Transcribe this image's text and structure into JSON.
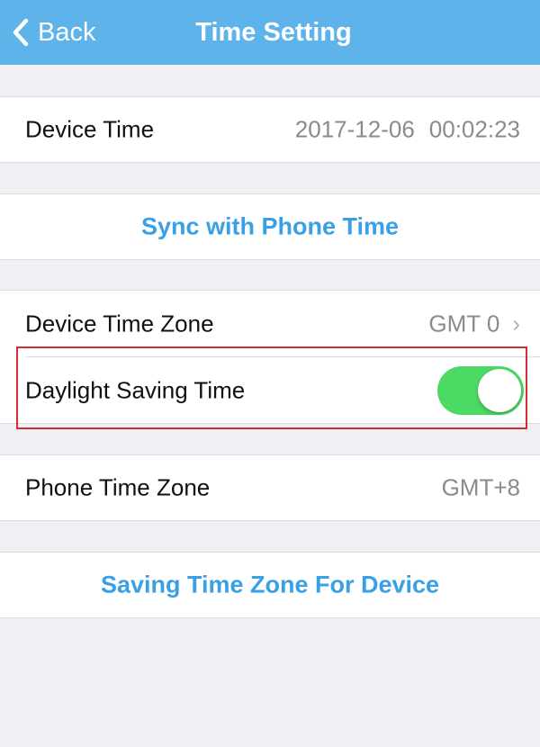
{
  "navbar": {
    "back_label": "Back",
    "title": "Time Setting"
  },
  "device_time": {
    "label": "Device Time",
    "date": "2017-12-06",
    "time": "00:02:23"
  },
  "sync_button": "Sync with Phone Time",
  "device_time_zone": {
    "label": "Device Time Zone",
    "value": "GMT 0",
    "chevron": "›"
  },
  "daylight_saving": {
    "label": "Daylight Saving Time",
    "enabled": true
  },
  "phone_time_zone": {
    "label": "Phone Time Zone",
    "value": "GMT+8"
  },
  "save_button": "Saving Time Zone For Device",
  "colors": {
    "navbar": "#5db3ea",
    "action_text": "#3aa0e6",
    "toggle_on": "#4cd964",
    "highlight": "#d32d2d",
    "background": "#efeff4"
  }
}
